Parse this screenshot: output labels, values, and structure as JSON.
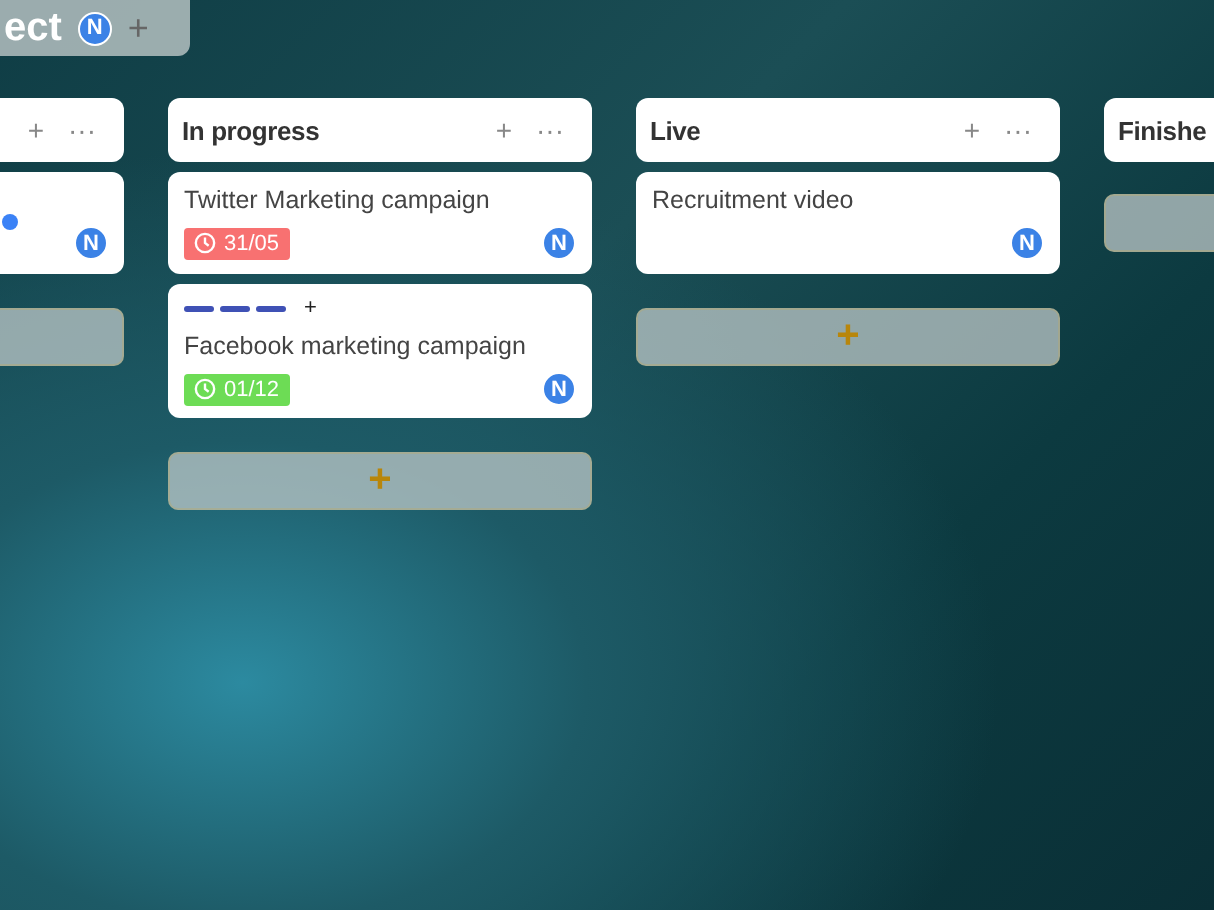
{
  "project": {
    "title": "ect",
    "avatar": "N",
    "add": "+"
  },
  "columns": [
    {
      "add": "+",
      "menu": "···",
      "cards": [
        {
          "color": "#3b82f6",
          "avatar": "N"
        }
      ]
    },
    {
      "title": "In progress",
      "add": "+",
      "menu": "···",
      "cards": [
        {
          "title": "Twitter Marketing campaign",
          "due": {
            "text": "31/05",
            "color": "#f87171"
          },
          "avatar": "N"
        },
        {
          "labels": [
            {
              "color": "#3f51b5"
            },
            {
              "color": "#3f51b5"
            },
            {
              "color": "#3f51b5"
            }
          ],
          "label_add": "+",
          "title": "Facebook marketing campaign",
          "due": {
            "text": "01/12",
            "color": "#6ddc55"
          },
          "avatar": "N"
        }
      ],
      "add_card": "+"
    },
    {
      "title": "Live",
      "add": "+",
      "menu": "···",
      "cards": [
        {
          "title": "Recruitment video",
          "avatar": "N"
        }
      ],
      "add_card": "+"
    },
    {
      "title": "Finishe"
    }
  ]
}
